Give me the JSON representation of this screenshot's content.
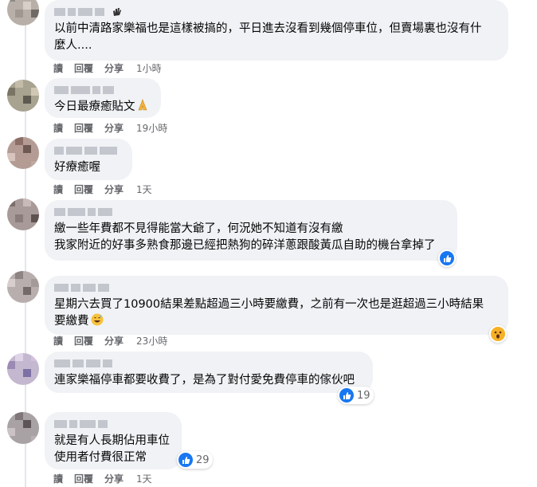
{
  "actions": {
    "read": "讀",
    "reply": "回覆",
    "share": "分享"
  },
  "comments": [
    {
      "text": "以前中清路家樂福也是這樣被搞的，平日進去沒看到幾個停車位，但賣場裏也沒有什\n麼人....",
      "time": "1小時"
    },
    {
      "text": "今日最療癒貼文",
      "emoji": "folded-hands-emoji",
      "time": "19小時"
    },
    {
      "text": "好療癒喔",
      "time": "1天"
    },
    {
      "text": "繳一些年費都不見得能當大爺了，何況她不知道有沒有繳\n我家附近的好事多熟食那邊已經把熱狗的碎洋蔥跟酸黃瓜自助的機台拿掉了",
      "reaction_icon": "like-icon"
    },
    {
      "text": "星期六去買了10900結果差點超過三小時要繳費，之前有一次也是逛超過三小時結果\n要繳費",
      "emoji": "grinning-sweat-emoji",
      "time": "23小時",
      "reaction_icon": "wow-icon"
    },
    {
      "text": "連家樂福停車都要收費了，是為了對付愛免費停車的傢伙吧",
      "reaction_icon": "like-icon",
      "reaction_count": "19"
    },
    {
      "text": "就是有人長期佔用車位\n使用者付費很正常",
      "time": "1天",
      "reaction_icon": "like-icon",
      "reaction_count": "29"
    }
  ],
  "colors": {
    "bubble": "#f0f2f5",
    "meta_text": "#65676b",
    "like_blue": "#1877f2",
    "wow_yellow": "#f7b125"
  }
}
